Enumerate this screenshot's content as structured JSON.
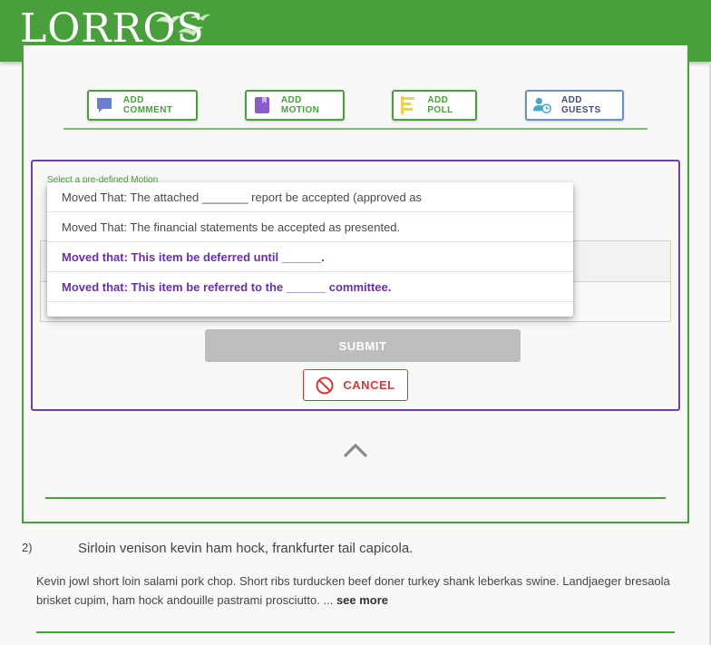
{
  "header": {
    "logo_text": "LORROS"
  },
  "actions": [
    {
      "label": "ADD COMMENT",
      "icon": "comment-icon"
    },
    {
      "label": "ADD MOTION",
      "icon": "motion-icon"
    },
    {
      "label": "ADD POLL",
      "icon": "poll-icon"
    },
    {
      "label": "ADD GUESTS",
      "icon": "guests-icon"
    }
  ],
  "motion_form": {
    "select_label": "Select a pre-defined Motion",
    "options": [
      "Moved That: The attached _______ report be accepted (approved as",
      "Moved That: The financial statements be accepted as presented.",
      "Moved that: This item be deferred until ______.",
      "Moved that: This item be referred to the ______ committee."
    ],
    "submit_label": "SUBMIT",
    "cancel_label": "CANCEL"
  },
  "agenda_item": {
    "number": "2)",
    "title": "Sirloin venison kevin ham hock, frankfurter tail capicola.",
    "description": "Kevin jowl short loin salami pork chop. Short ribs turducken beef doner turkey shank leberkas swine. Landjaeger bresaola brisket cupim, ham hock andouille pastrami prosciutto. ...",
    "see_more": "see more"
  },
  "colors": {
    "brand_green": "#4a9f3d",
    "motion_purple": "#6f3fa3",
    "cancel_red": "#d23b3b",
    "disabled_grey": "#bdbdbd"
  }
}
